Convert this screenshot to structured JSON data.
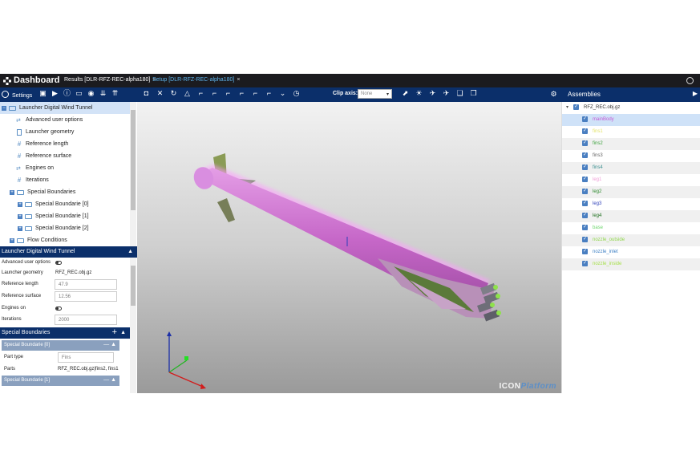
{
  "header": {
    "brand": "Dashboard",
    "tabs": [
      {
        "label": "Results [DLR-RFZ-REC-alpha180]"
      },
      {
        "label": "Setup [DLR-RFZ-REC-alpha180]"
      }
    ],
    "close_glyph": "×"
  },
  "toolbar": {
    "settings_label": "Settings",
    "clip_axis_label": "Clip axis:",
    "clip_axis_value": "None",
    "assemblies_title": "Assemblies"
  },
  "tree": {
    "root": "Launcher Digital Wind Tunnel",
    "items": [
      {
        "label": "Advanced user options",
        "icon": "arrows-icon"
      },
      {
        "label": "Launcher geometry",
        "icon": "document-icon"
      },
      {
        "label": "Reference length",
        "icon": "hash-icon"
      },
      {
        "label": "Reference surface",
        "icon": "hash-icon"
      },
      {
        "label": "Engines on",
        "icon": "arrows-icon"
      },
      {
        "label": "Iterations",
        "icon": "hash-icon"
      },
      {
        "label": "Special Boundaries",
        "icon": "folder-icon"
      },
      {
        "label": "Special Boundarie [0]",
        "icon": "folder-icon"
      },
      {
        "label": "Special Boundarie [1]",
        "icon": "folder-icon"
      },
      {
        "label": "Special Boundarie [2]",
        "icon": "folder-icon"
      },
      {
        "label": "Flow Conditions",
        "icon": "folder-icon"
      }
    ]
  },
  "properties": {
    "section_title": "Launcher Digital Wind Tunnel",
    "rows": [
      {
        "key": "Advanced user options",
        "type": "toggle"
      },
      {
        "key": "Launcher geometry",
        "value": "RFZ_REC.obj.gz"
      },
      {
        "key": "Reference length",
        "value": "47.9"
      },
      {
        "key": "Reference surface",
        "value": "12.56"
      },
      {
        "key": "Engines on",
        "type": "toggle"
      },
      {
        "key": "Iterations",
        "value": "2000"
      }
    ],
    "special_boundaries_title": "Special Boundaries",
    "sb0": {
      "title": "Special Boundarie [0]",
      "part_type_label": "Part type",
      "part_type_placeholder": "Fins",
      "parts_label": "Parts",
      "parts_value": "RFZ_REC.obj.gz|fins2, fins1"
    },
    "sb1_title": "Special Boundarie [1]"
  },
  "viewport": {
    "watermark_a": "ICON",
    "watermark_b": "Platform"
  },
  "assemblies": {
    "root": "RFZ_REC.obj.gz",
    "items": [
      {
        "name": "mainBody",
        "color": "#c45bd6"
      },
      {
        "name": "fins1",
        "color": "#e3e36a"
      },
      {
        "name": "fins2",
        "color": "#3fa33f"
      },
      {
        "name": "fins3",
        "color": "#666666"
      },
      {
        "name": "fins4",
        "color": "#3b8f8f"
      },
      {
        "name": "leg1",
        "color": "#f0a0d8"
      },
      {
        "name": "leg2",
        "color": "#2e8a2e"
      },
      {
        "name": "leg3",
        "color": "#3344bb"
      },
      {
        "name": "leg4",
        "color": "#1b6e1b"
      },
      {
        "name": "base",
        "color": "#6ed66e"
      },
      {
        "name": "nozzle_outside",
        "color": "#8fd64a"
      },
      {
        "name": "nozzle_inlet",
        "color": "#3c7fc4"
      },
      {
        "name": "nozzle_inside",
        "color": "#a6e04a"
      }
    ]
  }
}
